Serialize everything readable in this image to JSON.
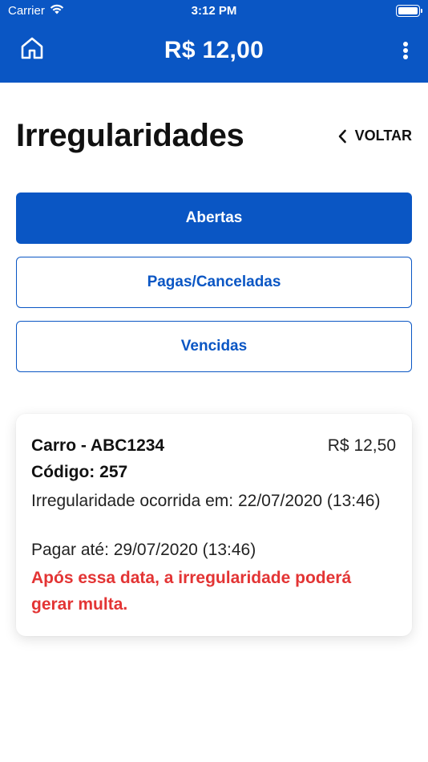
{
  "status_bar": {
    "carrier": "Carrier",
    "time": "3:12 PM",
    "wifi_icon": "wifi-icon",
    "battery_icon": "battery-icon"
  },
  "nav": {
    "balance": "R$ 12,00",
    "home_icon": "home-icon",
    "menu_icon": "more-vertical-icon",
    "color": "#0a56c4"
  },
  "header": {
    "title": "Irregularidades",
    "back_label": "VOLTAR",
    "back_icon": "chevron-left-icon"
  },
  "filters": {
    "open_label": "Abertas",
    "paid_label": "Pagas/Canceladas",
    "expired_label": "Vencidas",
    "selected": "Abertas"
  },
  "irregularity": {
    "vehicle": "Carro - ABC1234",
    "amount": "R$ 12,50",
    "code": "Código: 257",
    "occurred": "Irregularidade ocorrida em: 22/07/2020 (13:46)",
    "due": "Pagar até: 29/07/2020 (13:46)",
    "warning": "Após essa data, a irregularidade poderá gerar multa.",
    "warning_color": "#e33434"
  }
}
